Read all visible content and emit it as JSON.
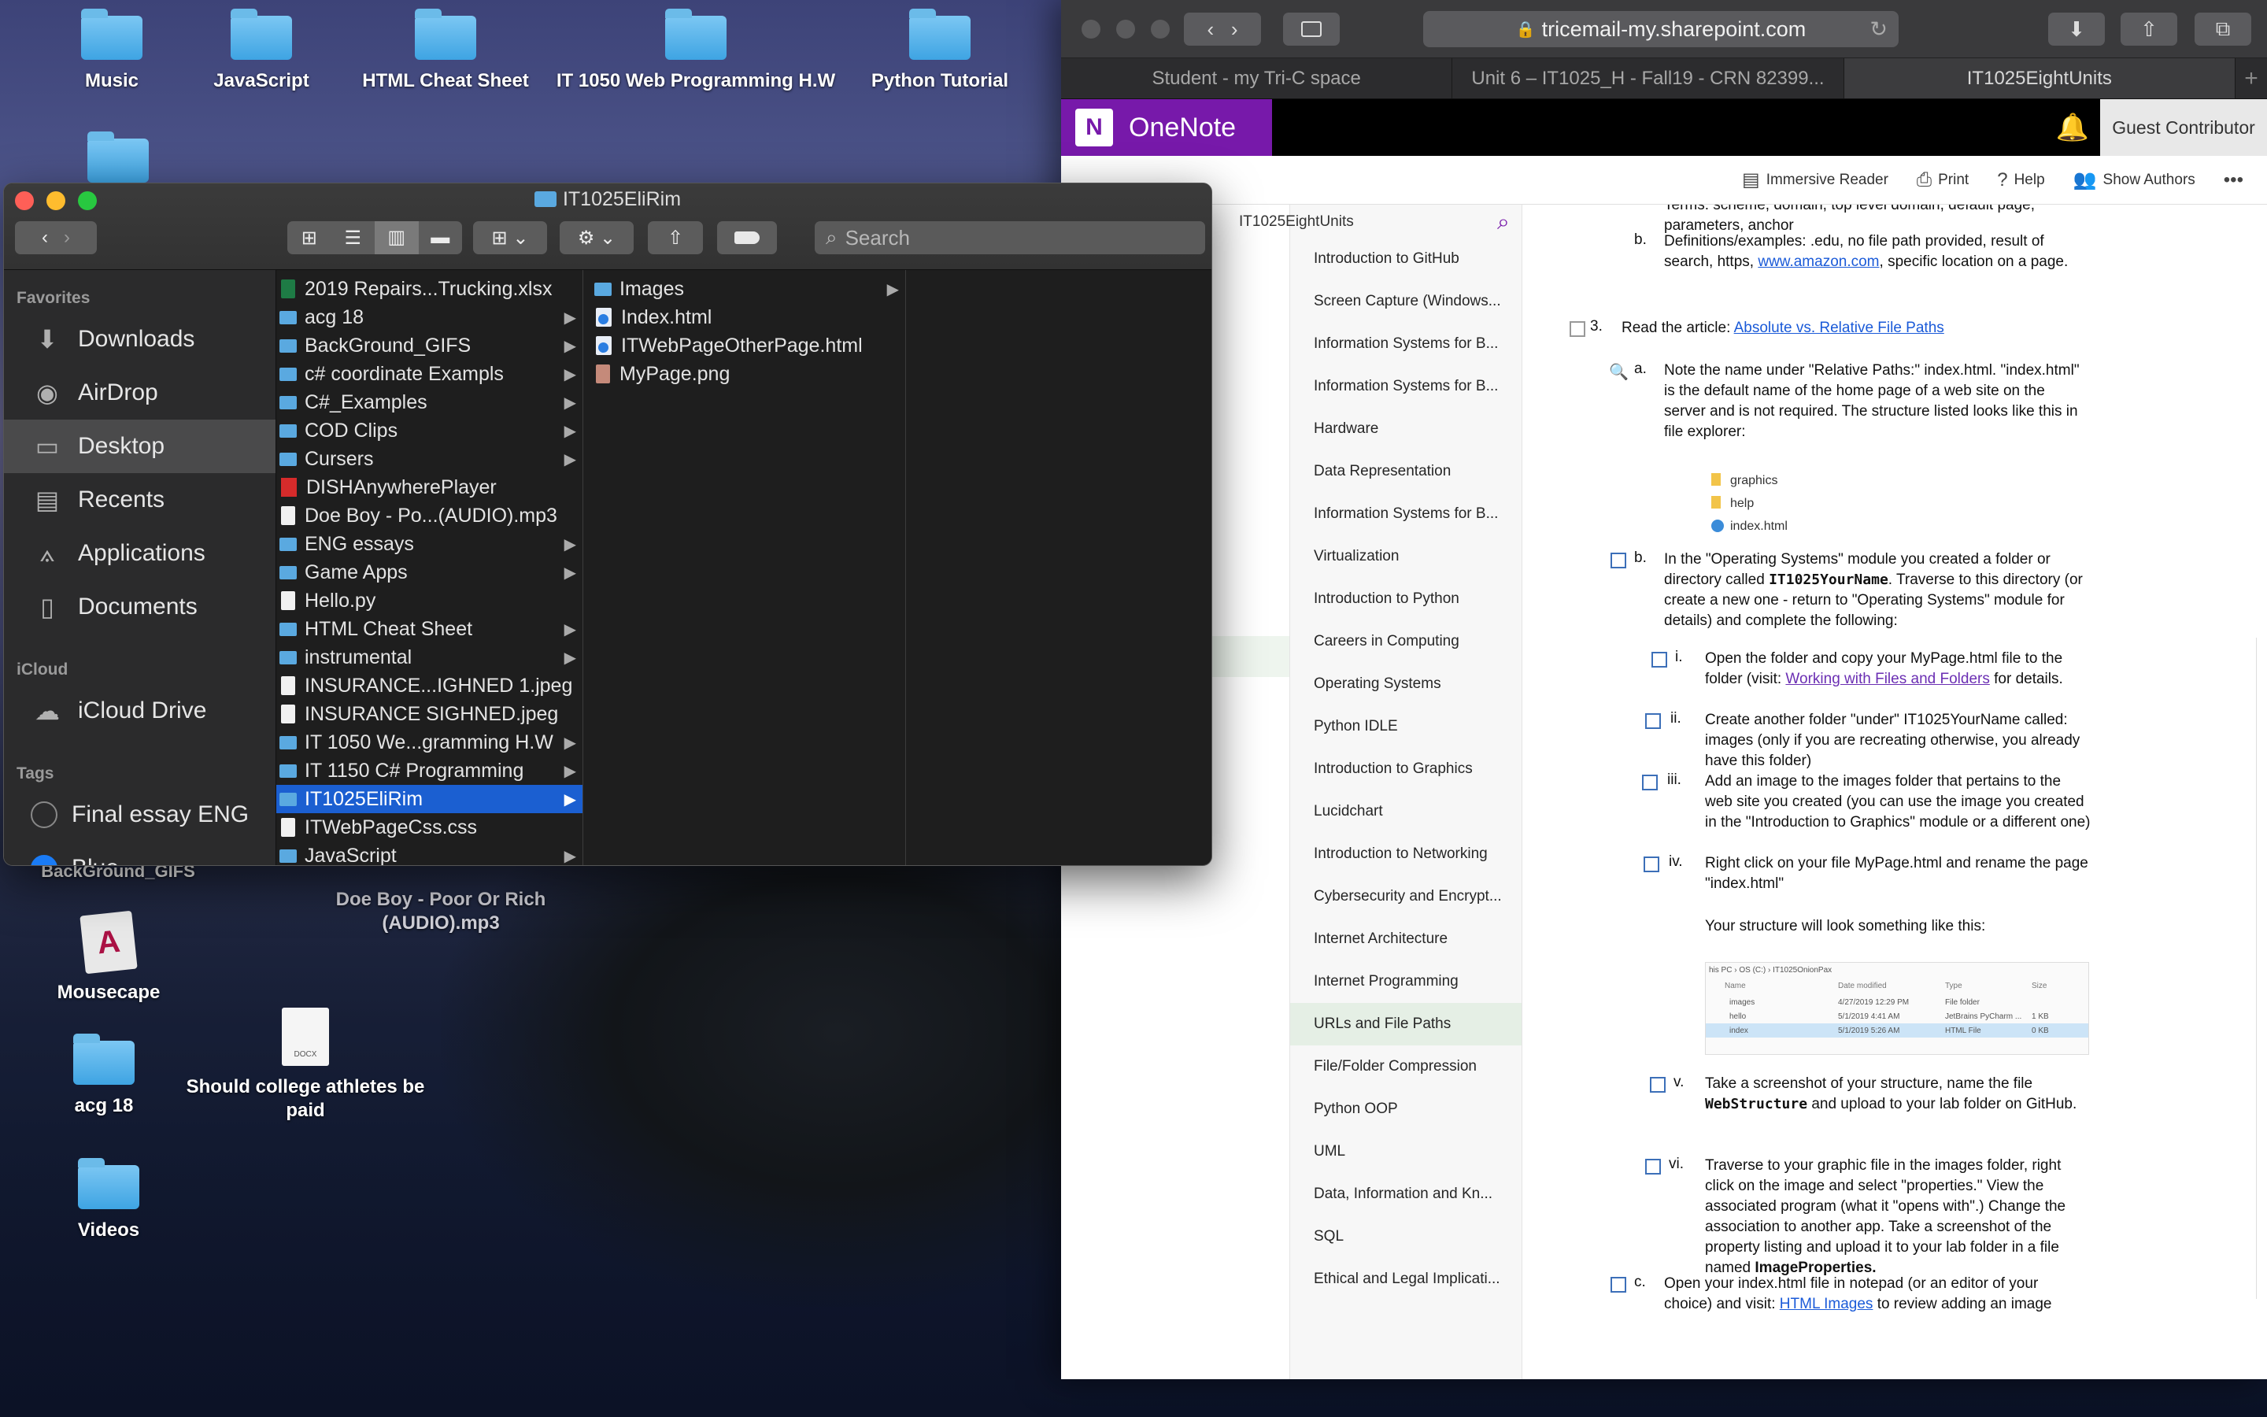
{
  "desktop": {
    "icons": [
      {
        "label": "Music"
      },
      {
        "label": "JavaScript"
      },
      {
        "label": "HTML Cheat Sheet"
      },
      {
        "label": "IT  1050 Web Programming H.W"
      },
      {
        "label": "Python Tutorial"
      },
      {
        "label": "BackGround_GIFS"
      },
      {
        "label": "Doe Boy - Poor Or Rich (AUDIO).mp3"
      },
      {
        "label": "Mousecape"
      },
      {
        "label": "Should college athletes be paid"
      },
      {
        "label": "acg  18"
      },
      {
        "label": "Videos"
      }
    ],
    "docx_badge": "DOCX"
  },
  "finder": {
    "title": "IT1025EliRim",
    "search_placeholder": "Search",
    "sidebar": {
      "favorites_header": "Favorites",
      "favorites": [
        "Downloads",
        "AirDrop",
        "Desktop",
        "Recents",
        "Applications",
        "Documents"
      ],
      "icloud_header": "iCloud",
      "icloud": [
        "iCloud Drive"
      ],
      "tags_header": "Tags",
      "tags": [
        {
          "label": "Final essay ENG",
          "color": "transparent"
        },
        {
          "label": "Blue",
          "color": "#1a7bf5"
        }
      ]
    },
    "column1": [
      {
        "name": "2019 Repairs...Trucking.xlsx",
        "kind": "file"
      },
      {
        "name": "acg  18",
        "kind": "folder"
      },
      {
        "name": "BackGround_GIFS",
        "kind": "folder"
      },
      {
        "name": "c# coordinate Exampls",
        "kind": "folder"
      },
      {
        "name": "C#_Examples",
        "kind": "folder"
      },
      {
        "name": "COD Clips",
        "kind": "folder"
      },
      {
        "name": "Cursers",
        "kind": "folder"
      },
      {
        "name": "DISHAnywherePlayer",
        "kind": "app"
      },
      {
        "name": "Doe Boy - Po...(AUDIO).mp3",
        "kind": "file"
      },
      {
        "name": "ENG essays",
        "kind": "folder"
      },
      {
        "name": "Game Apps",
        "kind": "folder"
      },
      {
        "name": "Hello.py",
        "kind": "file"
      },
      {
        "name": "HTML Cheat Sheet",
        "kind": "folder"
      },
      {
        "name": "instrumental",
        "kind": "folder"
      },
      {
        "name": "INSURANCE...IGHNED 1.jpeg",
        "kind": "file"
      },
      {
        "name": "INSURANCE SIGHNED.jpeg",
        "kind": "file"
      },
      {
        "name": "IT  1050 We...gramming H.W",
        "kind": "folder"
      },
      {
        "name": "IT 1150 C# Programming",
        "kind": "folder"
      },
      {
        "name": "IT1025EliRim",
        "kind": "folder",
        "selected": true
      },
      {
        "name": "ITWebPageCss.css",
        "kind": "file"
      },
      {
        "name": "JavaScript",
        "kind": "folder"
      }
    ],
    "column2": [
      {
        "name": "Images",
        "kind": "folder"
      },
      {
        "name": "Index.html",
        "kind": "html"
      },
      {
        "name": "ITWebPageOtherPage.html",
        "kind": "html"
      },
      {
        "name": "MyPage.png",
        "kind": "image"
      }
    ]
  },
  "safari": {
    "url": "tricemail-my.sharepoint.com",
    "tabs": [
      "Student - my Tri-C space",
      "Unit 6 – IT1025_H - Fall19 - CRN 82399...",
      "IT1025EightUnits"
    ],
    "active_tab": 2
  },
  "onenote": {
    "brand": "OneNote",
    "logo_letter": "N",
    "guest": "Guest Contributor",
    "ribbon": [
      "Immersive Reader",
      "Print",
      "Help",
      "Show Authors"
    ],
    "notebook": "IT1025EightUnits",
    "pages": [
      "Introduction to GitHub",
      "Screen Capture (Windows...",
      "Information Systems for B...",
      "Information Systems for B...",
      "Hardware",
      "Data Representation",
      "Information Systems for B...",
      "Virtualization",
      "Introduction to Python",
      "Careers in Computing",
      "Operating Systems",
      "Python IDLE",
      "Introduction to Graphics",
      "Lucidchart",
      "Introduction to Networking",
      "Cybersecurity and Encrypt...",
      "Internet Architecture",
      "Internet Programming",
      "URLs and File Paths",
      "File/Folder Compression",
      "Python OOP",
      "UML",
      "Data, Information and Kn...",
      "SQL",
      "Ethical and Legal Implicati..."
    ],
    "active_page": 18,
    "content": {
      "top_a_tail": "parameters, anchor",
      "top_a_cut": "Terms: scheme, domain, top level domain, default page,",
      "b_label": "b.",
      "b_text": "Definitions/examples: .edu, no file path provided, result of search, https,",
      "b_link": "www.amazon.com",
      "b_text2": ", specific location on a page.",
      "item3_num": "3.",
      "item3_text": "Read the article:",
      "item3_link": "Absolute vs. Relative File Paths",
      "a3_label": "a.",
      "a3_text": "Note the name under \"Relative Paths:\" index.html. \"index.html\" is the default name of the home page of a web site on the server and is not required.  The structure listed looks like this in file explorer:",
      "tree": [
        "graphics",
        "help",
        "index.html"
      ],
      "b3_label": "b.",
      "b3_text1": "In the \"Operating Systems\" module you created a folder or directory called",
      "b3_bold": "IT1025YourName",
      "b3_text2": ".  Traverse to this directory (or create a new one - return to \"Operating Systems\" module for details) and complete the following:",
      "i_label": "i.",
      "i_text1": "Open the folder and copy your MyPage.html file to the folder (visit:",
      "i_link": "Working with Files and Folders",
      "i_text2": "for details.",
      "ii_label": "ii.",
      "ii_text": "Create another folder \"under\" IT1025YourName called: images (only if you are recreating otherwise, you already have this folder)",
      "iii_label": "iii.",
      "iii_text": "Add an image to the images folder that pertains to the web site you created (you can use the image you created in the \"Introduction to Graphics\" module or a different one)",
      "iv_label": "iv.",
      "iv_text": "Right click on your file MyPage.html and rename the page \"index.html\"",
      "structure_text": "Your structure will look something like this:",
      "shot": {
        "crumb": "his PC  ›  OS (C:)  ›  IT1025OnionPax",
        "headers": [
          "Name",
          "Date modified",
          "Type",
          "Size"
        ],
        "rows": [
          [
            "images",
            "4/27/2019 12:29 PM",
            "File folder",
            ""
          ],
          [
            "hello",
            "5/1/2019 4:41 AM",
            "JetBrains PyCharm ...",
            "1 KB"
          ],
          [
            "index",
            "5/1/2019 5:26 AM",
            "HTML File",
            "0 KB"
          ]
        ]
      },
      "v_label": "v.",
      "v_text1": "Take a screenshot of your structure, name the file",
      "v_bold": "WebStructure",
      "v_text2": "and upload to your lab folder on GitHub.",
      "vi_label": "vi.",
      "vi_text1": "Traverse to your graphic file in the images folder, right click on the image and select \"properties.\" View the associated program (what it \"opens with\".) Change the association to another app. Take a screenshot of the property listing and upload it to your lab folder in a file named",
      "vi_bold": "ImageProperties.",
      "c_label": "c.",
      "c_text1": "Open your index.html file in notepad (or an editor of your choice) and visit:",
      "c_link": "HTML Images",
      "c_text2": "to review adding an image"
    }
  }
}
